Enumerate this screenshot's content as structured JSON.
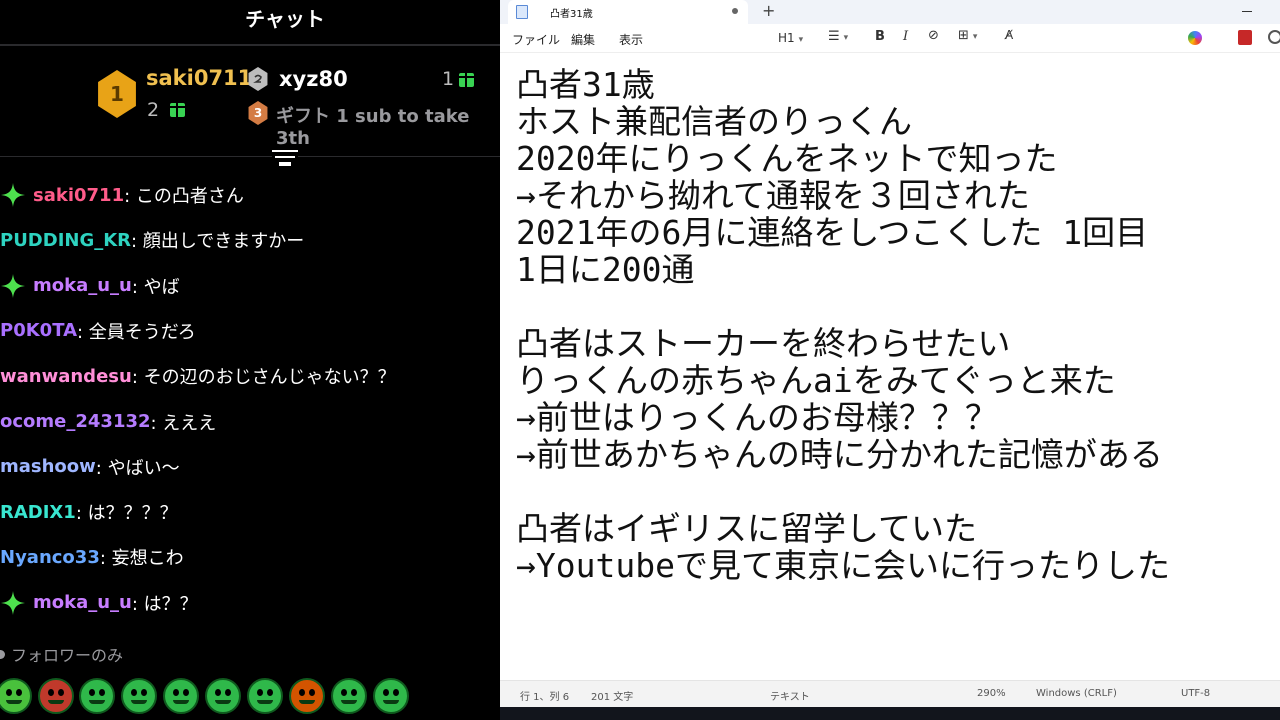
{
  "chat": {
    "title": "チャット",
    "leaderboard": {
      "first": {
        "rank": "1",
        "name": "saki0711",
        "count": "2"
      },
      "second": {
        "rank": "",
        "name": "xyz80",
        "count": "1"
      },
      "third": {
        "rank": "3",
        "text": "ギフト 1 sub to take 3th"
      }
    },
    "messages": [
      {
        "user": "saki0711",
        "text": ": この凸者さん",
        "color": "#ff5c8a",
        "badge": true
      },
      {
        "user": "PUDDING_KR",
        "text": ": 顔出しできますかー",
        "color": "#2ed3c0",
        "badge": false
      },
      {
        "user": "moka_u_u",
        "text": ": やば",
        "color": "#c77dff",
        "badge": true
      },
      {
        "user": "P0K0TA",
        "text": ": 全員そうだろ",
        "color": "#a970ff",
        "badge": false
      },
      {
        "user": "wanwandesu",
        "text": ": その辺のおじさんじゃない？？",
        "color": "#ff8fd8",
        "badge": false
      },
      {
        "user": "ocome_243132",
        "text": ": えええ",
        "color": "#b57cff",
        "badge": false
      },
      {
        "user": "mashoow",
        "text": ": やばい～",
        "color": "#9fb6ff",
        "badge": false
      },
      {
        "user": "RADIX1",
        "text": ": は？？？？",
        "color": "#39e6d0",
        "badge": false
      },
      {
        "user": "Nyanco33",
        "text": ": 妄想こわ",
        "color": "#6aa8ff",
        "badge": false
      },
      {
        "user": "moka_u_u",
        "text": ": は？？",
        "color": "#c77dff",
        "badge": true
      }
    ],
    "followers_only": "フォロワーのみ"
  },
  "notepad": {
    "tab_title": "凸者31歳",
    "new_tab": "+",
    "menu": {
      "file": "ファイル",
      "edit": "編集",
      "view": "表示"
    },
    "toolbar": {
      "heading": "H1",
      "bold": "B",
      "italic": "I"
    },
    "lines": [
      "凸者31歳",
      "ホスト兼配信者のりっくん",
      "2020年にりっくんをネットで知った",
      "→それから拗れて通報を３回された",
      "2021年の6月に連絡をしつこくした 1回目",
      "1日に200通",
      "",
      "凸者はストーカーを終わらせたい",
      "りっくんの赤ちゃんaiをみてぐっと来た",
      "→前世はりっくんのお母様？？？",
      "→前世あかちゃんの時に分かれた記憶がある",
      "",
      "凸者はイギリスに留学していた",
      "→Youtubeで見て東京に会いに行ったりした"
    ],
    "status": {
      "position": "行 1、列 6",
      "chars": "201 文字",
      "format": "テキスト",
      "zoom": "290%",
      "line_ending": "Windows (CRLF)",
      "encoding": "UTF-8"
    }
  }
}
